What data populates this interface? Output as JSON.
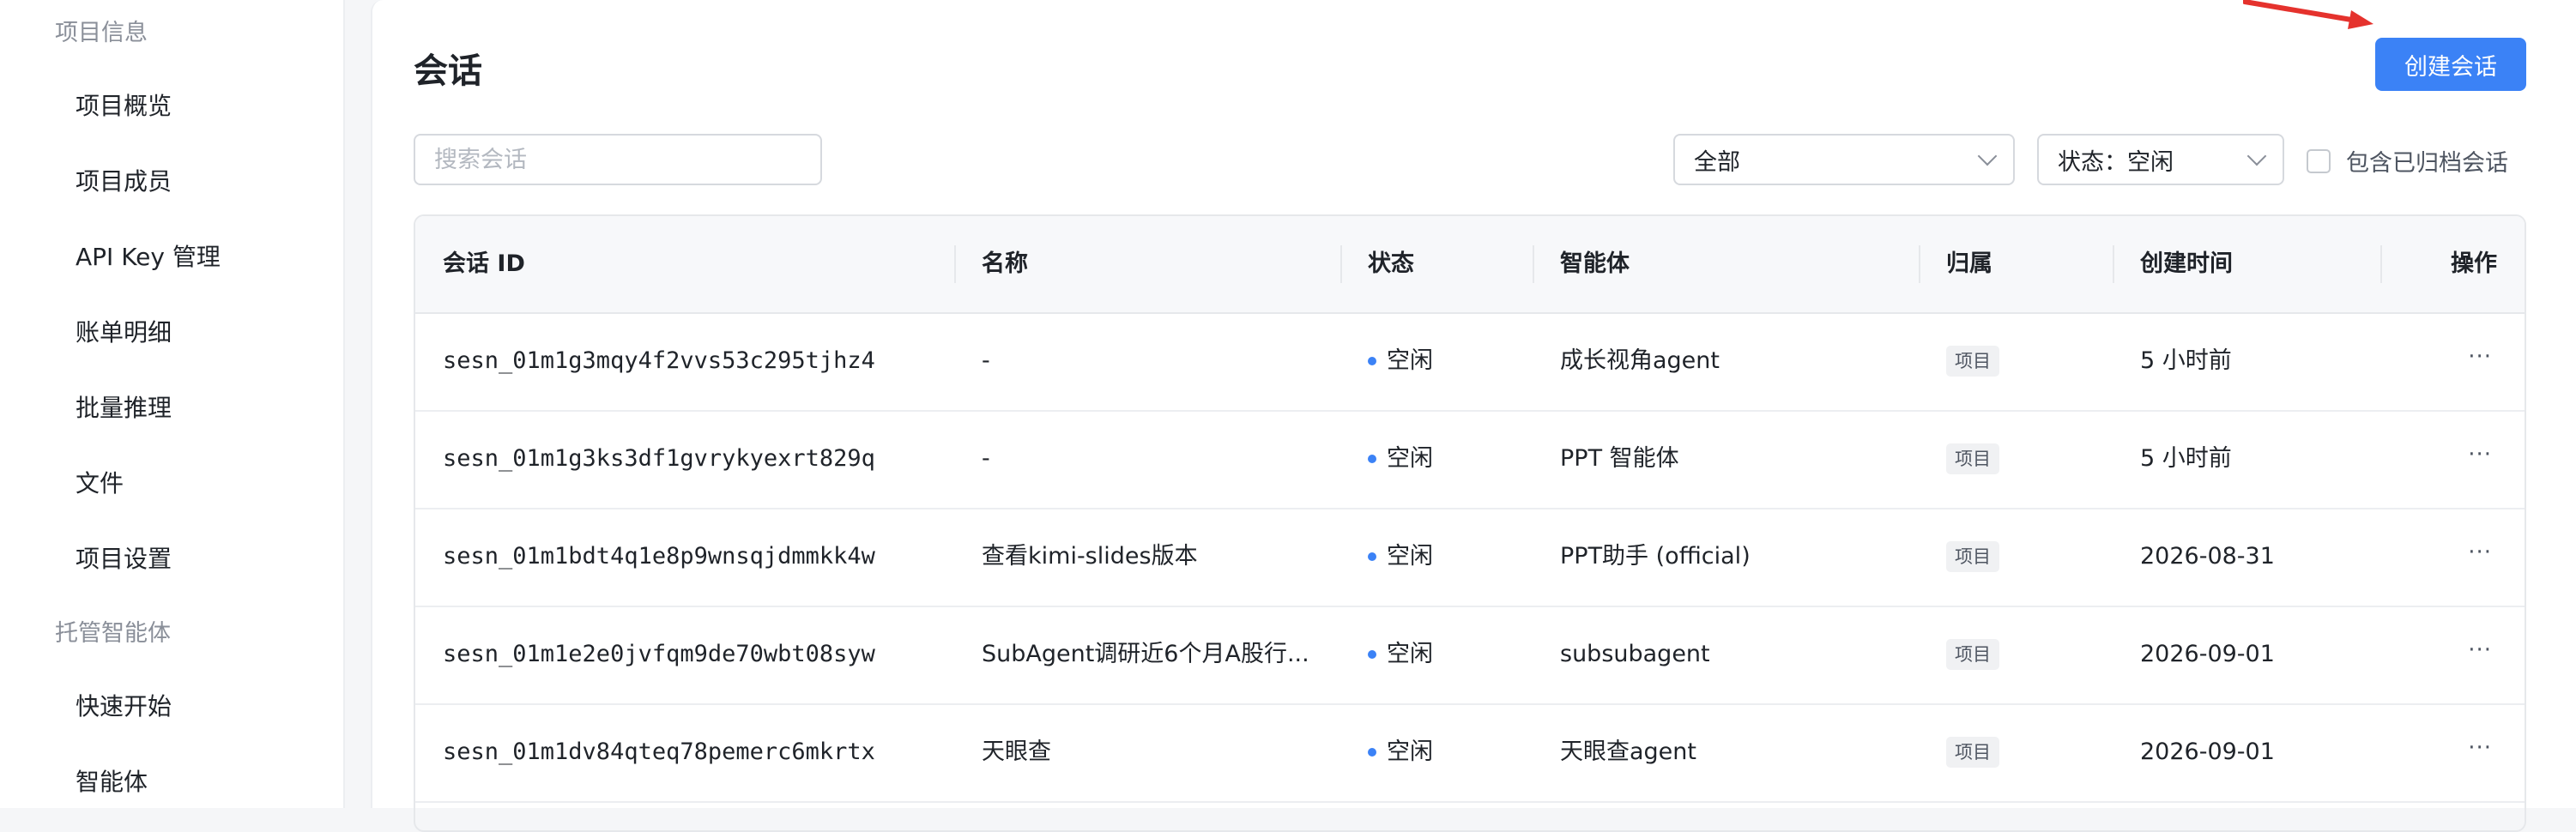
{
  "sidebar": {
    "section_project": "项目信息",
    "items_project": [
      {
        "label": "项目概览"
      },
      {
        "label": "项目成员"
      },
      {
        "label": "API Key 管理"
      },
      {
        "label": "账单明细"
      },
      {
        "label": "批量推理"
      },
      {
        "label": "文件"
      },
      {
        "label": "项目设置"
      }
    ],
    "section_agent": "托管智能体",
    "items_agent": [
      {
        "label": "快速开始"
      },
      {
        "label": "智能体"
      }
    ]
  },
  "main": {
    "title": "会话",
    "create_button": "创建会话",
    "search_placeholder": "搜索会话",
    "filter_scope": "全部",
    "filter_status": "状态：空闲",
    "include_archived_label": "包含已归档会话"
  },
  "table": {
    "headers": {
      "id": "会话 ID",
      "name": "名称",
      "status": "状态",
      "agent": "智能体",
      "owner": "归属",
      "created": "创建时间",
      "actions": "操作"
    },
    "rows": [
      {
        "id": "sesn_01m1g3mqy4f2vvs53c295tjhz4",
        "name": "-",
        "status": "空闲",
        "agent": "成长视角agent",
        "owner": "项目",
        "created": "5 小时前",
        "more": "···"
      },
      {
        "id": "sesn_01m1g3ks3df1gvrykyexrt829q",
        "name": "-",
        "status": "空闲",
        "agent": "PPT 智能体",
        "owner": "项目",
        "created": "5 小时前",
        "more": "···"
      },
      {
        "id": "sesn_01m1bdt4q1e8p9wnsqjdmmkk4w",
        "name": "查看kimi-slides版本",
        "status": "空闲",
        "agent": "PPT助手 (official)",
        "owner": "项目",
        "created": "2026-08-31",
        "more": "···"
      },
      {
        "id": "sesn_01m1e2e0jvfqm9de70wbt08syw",
        "name": "SubAgent调研近6个月A股行...",
        "status": "空闲",
        "agent": "subsubagent",
        "owner": "项目",
        "created": "2026-09-01",
        "more": "···"
      },
      {
        "id": "sesn_01m1dv84qteq78pemerc6mkrtx",
        "name": "天眼查",
        "status": "空闲",
        "agent": "天眼查agent",
        "owner": "项目",
        "created": "2026-09-01",
        "more": "···"
      }
    ]
  },
  "colors": {
    "accent": "#3b82f6",
    "annotation_arrow": "#e5322d"
  }
}
